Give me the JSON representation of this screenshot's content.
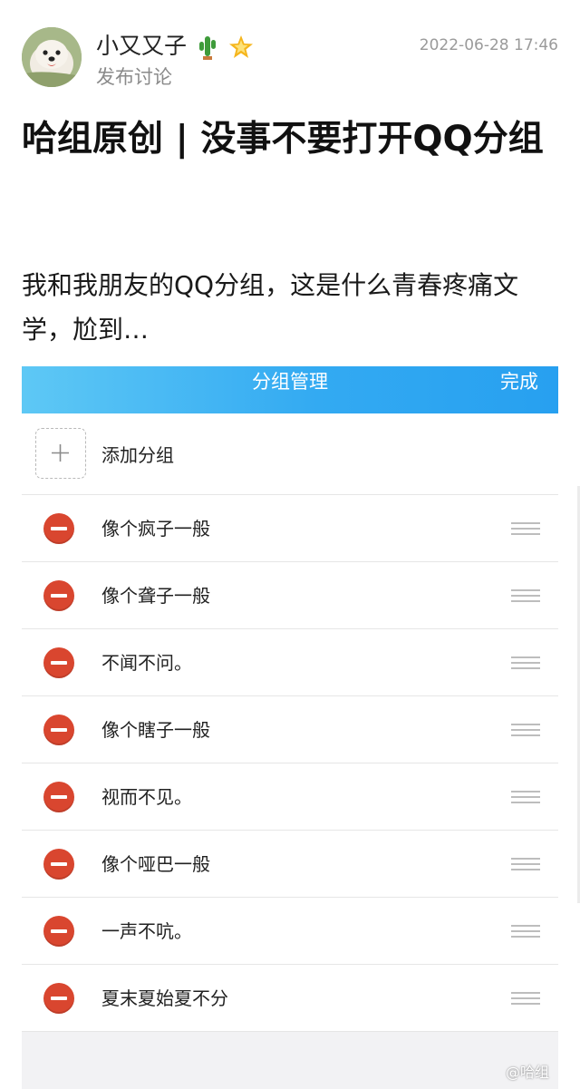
{
  "post": {
    "author": "小又又子",
    "author_emojis": [
      "cactus-icon",
      "star-icon"
    ],
    "subtitle": "发布讨论",
    "timestamp": "2022-06-28 17:46",
    "title": "哈组原创 | 没事不要打开QQ分组",
    "body": "我和我朋友的QQ分组，这是什么青春疼痛文学，尬到…"
  },
  "screenshot": {
    "nav_title": "分组管理",
    "nav_done": "完成",
    "add_label": "添加分组",
    "groups": [
      "像个疯子一般",
      "像个聋子一般",
      "不闻不问。",
      "像个瞎子一般",
      "视而不见。",
      "像个哑巴一般",
      "一声不吭。",
      "夏末夏始夏不分"
    ],
    "colors": {
      "nav_start": "#5ec8f5",
      "nav_end": "#27a0f0",
      "delete_red": "#d9462f"
    }
  },
  "watermark": "@哈组"
}
